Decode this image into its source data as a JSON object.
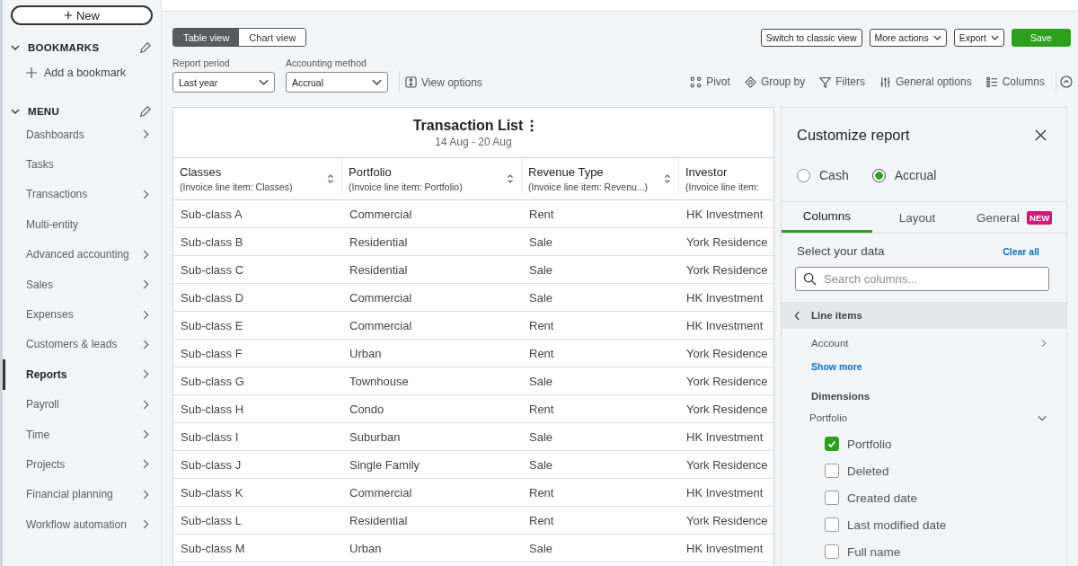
{
  "sidebar": {
    "new_button": "New",
    "bookmarks": {
      "title": "BOOKMARKS",
      "expanded": true,
      "add_label": "Add a bookmark"
    },
    "menu": {
      "title": "MENU",
      "expanded": true,
      "items": [
        {
          "label": "Dashboards",
          "has_submenu": true,
          "selected": false
        },
        {
          "label": "Tasks",
          "has_submenu": false,
          "selected": false
        },
        {
          "label": "Transactions",
          "has_submenu": true,
          "selected": false
        },
        {
          "label": "Multi-entity",
          "has_submenu": false,
          "selected": false
        },
        {
          "label": "Advanced accounting",
          "has_submenu": true,
          "selected": false
        },
        {
          "label": "Sales",
          "has_submenu": true,
          "selected": false
        },
        {
          "label": "Expenses",
          "has_submenu": true,
          "selected": false
        },
        {
          "label": "Customers & leads",
          "has_submenu": true,
          "selected": false
        },
        {
          "label": "Reports",
          "has_submenu": true,
          "selected": true
        },
        {
          "label": "Payroll",
          "has_submenu": true,
          "selected": false
        },
        {
          "label": "Time",
          "has_submenu": true,
          "selected": false
        },
        {
          "label": "Projects",
          "has_submenu": true,
          "selected": false
        },
        {
          "label": "Financial planning",
          "has_submenu": true,
          "selected": false
        },
        {
          "label": "Workflow automation",
          "has_submenu": true,
          "selected": false
        }
      ]
    }
  },
  "view_toggle": [
    {
      "label": "Table view",
      "selected": true
    },
    {
      "label": "Chart view",
      "selected": false
    }
  ],
  "actions": [
    {
      "label": "Switch to classic view",
      "kind": "plain"
    },
    {
      "label": "More actions",
      "kind": "dropdown"
    },
    {
      "label": "Export",
      "kind": "dropdown"
    },
    {
      "label": "Save",
      "kind": "primary"
    }
  ],
  "filters": [
    {
      "label": "Report period",
      "value": "Last year"
    },
    {
      "label": "Accounting method",
      "value": "Accrual"
    }
  ],
  "view_options": "View options",
  "tools": [
    {
      "label": "Pivot",
      "kind": "pivot"
    },
    {
      "label": "Group by",
      "kind": "group"
    },
    {
      "label": "Filters",
      "kind": "filter"
    },
    {
      "label": "General options",
      "kind": "options"
    },
    {
      "label": "Columns",
      "kind": "columns"
    }
  ],
  "report": {
    "title": "Transaction List",
    "subtitle": "14 Aug - 20 Aug",
    "columns": [
      {
        "name": "Classes",
        "source": "(Invoice line item: Classes)",
        "sortable": true
      },
      {
        "name": "Portfolio",
        "source": "(Invoice line item: Portfolio)",
        "sortable": true
      },
      {
        "name": "Revenue Type",
        "source": "(Invoice line item: Revenu...)",
        "sortable": true
      },
      {
        "name": "Investor",
        "source": "(Invoice line item:",
        "sortable": false
      }
    ],
    "rows": [
      [
        "Sub-class A",
        "Commercial",
        "Rent",
        "HK Investment"
      ],
      [
        "Sub-class B",
        "Residential",
        "Sale",
        "York Residence"
      ],
      [
        "Sub-class C",
        "Residential",
        "Sale",
        "York Residence"
      ],
      [
        "Sub-class D",
        "Commercial",
        "Sale",
        "HK Investment"
      ],
      [
        "Sub-class E",
        "Commercial",
        "Rent",
        "HK Investment"
      ],
      [
        "Sub-class F",
        "Urban",
        "Rent",
        "York Residence"
      ],
      [
        "Sub-class G",
        "Townhouse",
        "Sale",
        "York Residence"
      ],
      [
        "Sub-class H",
        "Condo",
        "Rent",
        "York Residence"
      ],
      [
        "Sub-class I",
        "Suburban",
        "Sale",
        "HK Investment"
      ],
      [
        "Sub-class J",
        "Single Family",
        "Sale",
        "York Residence"
      ],
      [
        "Sub-class K",
        "Commercial",
        "Rent",
        "HK Investment"
      ],
      [
        "Sub-class L",
        "Residential",
        "Rent",
        "York Residence"
      ],
      [
        "Sub-class M",
        "Urban",
        "Sale",
        "HK Investment"
      ]
    ]
  },
  "panel": {
    "title": "Customize report",
    "methods": [
      {
        "label": "Cash",
        "selected": false
      },
      {
        "label": "Accrual",
        "selected": true
      }
    ],
    "tabs": [
      {
        "label": "Columns",
        "selected": true
      },
      {
        "label": "Layout",
        "selected": false
      },
      {
        "label": "General",
        "selected": false,
        "badge": "NEW"
      }
    ],
    "select_label": "Select your data",
    "clear_all": "Clear all",
    "search": {
      "placeholder": "Search columns..."
    },
    "section": "Line items",
    "account": "Account",
    "show_more": "Show more",
    "dimensions": "Dimensions",
    "group": {
      "label": "Portfolio",
      "expanded": true
    },
    "options": [
      {
        "label": "Portfolio",
        "checked": true
      },
      {
        "label": "Deleted",
        "checked": false
      },
      {
        "label": "Created date",
        "checked": false
      },
      {
        "label": "Last modified date",
        "checked": false
      },
      {
        "label": "Full name",
        "checked": false
      }
    ]
  }
}
